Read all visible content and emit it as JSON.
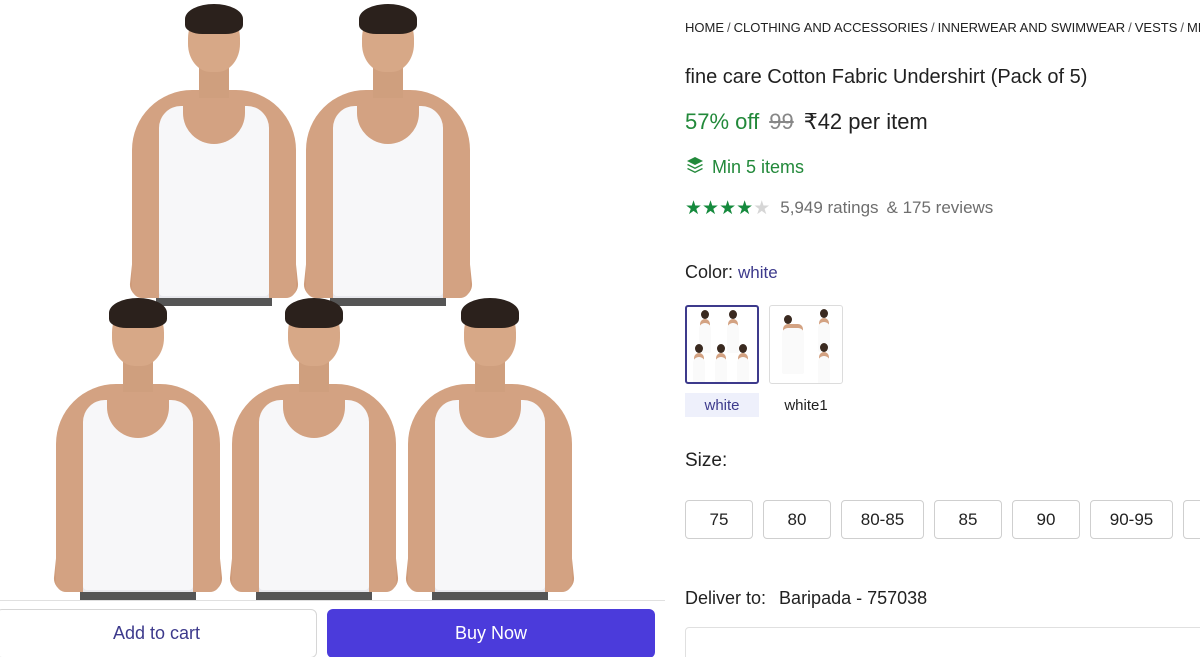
{
  "breadcrumb": [
    "HOME",
    "CLOTHING AND ACCESSORIES",
    "INNERWEAR AND SWIMWEAR",
    "VESTS",
    "MEN'S V"
  ],
  "product": {
    "title": "fine care Cotton Fabric Undershirt (Pack of 5)",
    "discount": "57% off",
    "mrp": "99",
    "price": "₹42 per item",
    "min_items": "Min 5 items",
    "rating_value": 4,
    "rating_max": 5,
    "ratings_text": "5,949 ratings",
    "reviews_text": "& 175 reviews"
  },
  "color": {
    "label": "Color:",
    "selected": "white",
    "options": [
      "white",
      "white1"
    ]
  },
  "size": {
    "label": "Size:",
    "options": [
      "75",
      "80",
      "80-85",
      "85",
      "90",
      "90-95"
    ]
  },
  "delivery": {
    "label": "Deliver to:",
    "location": "Baripada - 757038"
  },
  "actions": {
    "add_to_cart": "Add to cart",
    "buy_now": "Buy Now"
  },
  "icons": {
    "min_items": "layers-icon",
    "star_filled": "star-icon",
    "star_empty": "star-outline-icon"
  },
  "colors": {
    "accent": "#4b3bdb",
    "success": "#22893a",
    "link": "#3d3a8c"
  }
}
